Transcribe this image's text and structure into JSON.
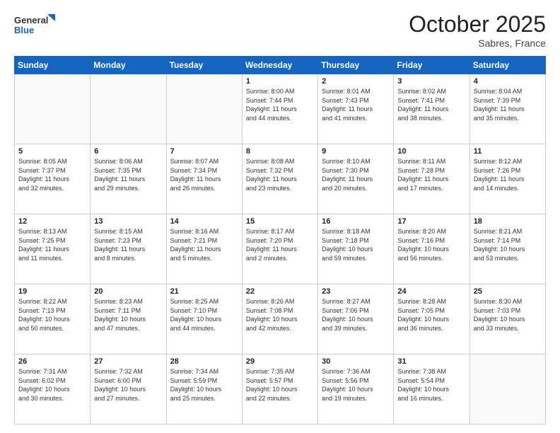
{
  "header": {
    "logo_general": "General",
    "logo_blue": "Blue",
    "month": "October 2025",
    "location": "Sabres, France"
  },
  "days_of_week": [
    "Sunday",
    "Monday",
    "Tuesday",
    "Wednesday",
    "Thursday",
    "Friday",
    "Saturday"
  ],
  "weeks": [
    [
      {
        "day": "",
        "info": ""
      },
      {
        "day": "",
        "info": ""
      },
      {
        "day": "",
        "info": ""
      },
      {
        "day": "1",
        "info": "Sunrise: 8:00 AM\nSunset: 7:44 PM\nDaylight: 11 hours\nand 44 minutes."
      },
      {
        "day": "2",
        "info": "Sunrise: 8:01 AM\nSunset: 7:43 PM\nDaylight: 11 hours\nand 41 minutes."
      },
      {
        "day": "3",
        "info": "Sunrise: 8:02 AM\nSunset: 7:41 PM\nDaylight: 11 hours\nand 38 minutes."
      },
      {
        "day": "4",
        "info": "Sunrise: 8:04 AM\nSunset: 7:39 PM\nDaylight: 11 hours\nand 35 minutes."
      }
    ],
    [
      {
        "day": "5",
        "info": "Sunrise: 8:05 AM\nSunset: 7:37 PM\nDaylight: 11 hours\nand 32 minutes."
      },
      {
        "day": "6",
        "info": "Sunrise: 8:06 AM\nSunset: 7:35 PM\nDaylight: 11 hours\nand 29 minutes."
      },
      {
        "day": "7",
        "info": "Sunrise: 8:07 AM\nSunset: 7:34 PM\nDaylight: 11 hours\nand 26 minutes."
      },
      {
        "day": "8",
        "info": "Sunrise: 8:08 AM\nSunset: 7:32 PM\nDaylight: 11 hours\nand 23 minutes."
      },
      {
        "day": "9",
        "info": "Sunrise: 8:10 AM\nSunset: 7:30 PM\nDaylight: 11 hours\nand 20 minutes."
      },
      {
        "day": "10",
        "info": "Sunrise: 8:11 AM\nSunset: 7:28 PM\nDaylight: 11 hours\nand 17 minutes."
      },
      {
        "day": "11",
        "info": "Sunrise: 8:12 AM\nSunset: 7:26 PM\nDaylight: 11 hours\nand 14 minutes."
      }
    ],
    [
      {
        "day": "12",
        "info": "Sunrise: 8:13 AM\nSunset: 7:25 PM\nDaylight: 11 hours\nand 11 minutes."
      },
      {
        "day": "13",
        "info": "Sunrise: 8:15 AM\nSunset: 7:23 PM\nDaylight: 11 hours\nand 8 minutes."
      },
      {
        "day": "14",
        "info": "Sunrise: 8:16 AM\nSunset: 7:21 PM\nDaylight: 11 hours\nand 5 minutes."
      },
      {
        "day": "15",
        "info": "Sunrise: 8:17 AM\nSunset: 7:20 PM\nDaylight: 11 hours\nand 2 minutes."
      },
      {
        "day": "16",
        "info": "Sunrise: 8:18 AM\nSunset: 7:18 PM\nDaylight: 10 hours\nand 59 minutes."
      },
      {
        "day": "17",
        "info": "Sunrise: 8:20 AM\nSunset: 7:16 PM\nDaylight: 10 hours\nand 56 minutes."
      },
      {
        "day": "18",
        "info": "Sunrise: 8:21 AM\nSunset: 7:14 PM\nDaylight: 10 hours\nand 53 minutes."
      }
    ],
    [
      {
        "day": "19",
        "info": "Sunrise: 8:22 AM\nSunset: 7:13 PM\nDaylight: 10 hours\nand 50 minutes."
      },
      {
        "day": "20",
        "info": "Sunrise: 8:23 AM\nSunset: 7:11 PM\nDaylight: 10 hours\nand 47 minutes."
      },
      {
        "day": "21",
        "info": "Sunrise: 8:25 AM\nSunset: 7:10 PM\nDaylight: 10 hours\nand 44 minutes."
      },
      {
        "day": "22",
        "info": "Sunrise: 8:26 AM\nSunset: 7:08 PM\nDaylight: 10 hours\nand 42 minutes."
      },
      {
        "day": "23",
        "info": "Sunrise: 8:27 AM\nSunset: 7:06 PM\nDaylight: 10 hours\nand 39 minutes."
      },
      {
        "day": "24",
        "info": "Sunrise: 8:28 AM\nSunset: 7:05 PM\nDaylight: 10 hours\nand 36 minutes."
      },
      {
        "day": "25",
        "info": "Sunrise: 8:30 AM\nSunset: 7:03 PM\nDaylight: 10 hours\nand 33 minutes."
      }
    ],
    [
      {
        "day": "26",
        "info": "Sunrise: 7:31 AM\nSunset: 6:02 PM\nDaylight: 10 hours\nand 30 minutes."
      },
      {
        "day": "27",
        "info": "Sunrise: 7:32 AM\nSunset: 6:00 PM\nDaylight: 10 hours\nand 27 minutes."
      },
      {
        "day": "28",
        "info": "Sunrise: 7:34 AM\nSunset: 5:59 PM\nDaylight: 10 hours\nand 25 minutes."
      },
      {
        "day": "29",
        "info": "Sunrise: 7:35 AM\nSunset: 5:57 PM\nDaylight: 10 hours\nand 22 minutes."
      },
      {
        "day": "30",
        "info": "Sunrise: 7:36 AM\nSunset: 5:56 PM\nDaylight: 10 hours\nand 19 minutes."
      },
      {
        "day": "31",
        "info": "Sunrise: 7:38 AM\nSunset: 5:54 PM\nDaylight: 10 hours\nand 16 minutes."
      },
      {
        "day": "",
        "info": ""
      }
    ]
  ]
}
